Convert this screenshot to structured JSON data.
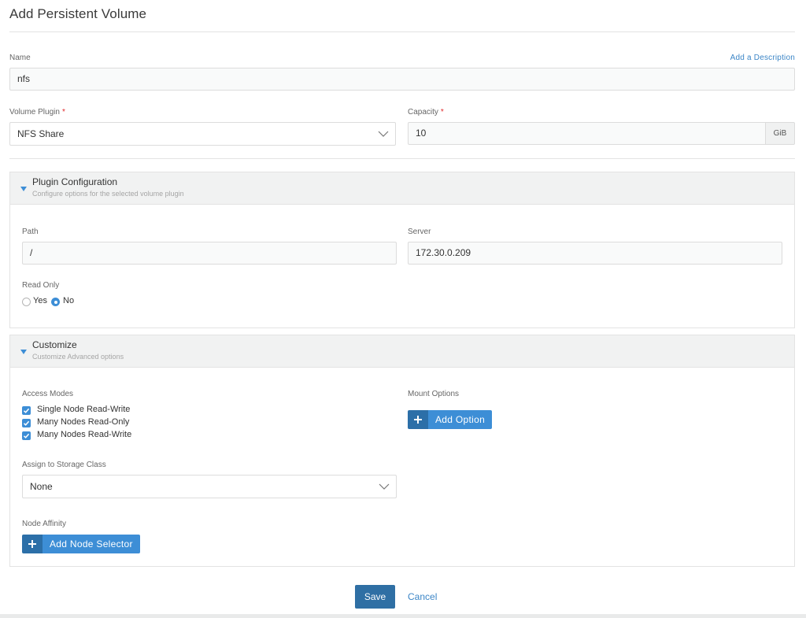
{
  "page": {
    "title": "Add Persistent Volume"
  },
  "name": {
    "label": "Name",
    "value": "nfs",
    "add_description_label": "Add a Description"
  },
  "volume_plugin": {
    "label": "Volume Plugin",
    "required_mark": "*",
    "value": "NFS Share"
  },
  "capacity": {
    "label": "Capacity",
    "required_mark": "*",
    "value": "10",
    "unit": "GiB"
  },
  "plugin_config": {
    "title": "Plugin Configuration",
    "subtitle": "Configure options for the selected volume plugin",
    "path": {
      "label": "Path",
      "value": "/"
    },
    "server": {
      "label": "Server",
      "value": "172.30.0.209"
    },
    "read_only": {
      "label": "Read Only",
      "options": [
        "Yes",
        "No"
      ],
      "selected": "No"
    }
  },
  "customize": {
    "title": "Customize",
    "subtitle": "Customize Advanced options",
    "access_modes": {
      "label": "Access Modes",
      "items": [
        {
          "label": "Single Node Read-Write",
          "checked": true
        },
        {
          "label": "Many Nodes Read-Only",
          "checked": true
        },
        {
          "label": "Many Nodes Read-Write",
          "checked": true
        }
      ]
    },
    "mount_options": {
      "label": "Mount Options",
      "add_label": "Add Option"
    },
    "storage_class": {
      "label": "Assign to Storage Class",
      "value": "None"
    },
    "node_affinity": {
      "label": "Node Affinity",
      "add_label": "Add Node Selector"
    }
  },
  "footer": {
    "save_label": "Save",
    "cancel_label": "Cancel"
  },
  "colors": {
    "accent": "#3d8ed6",
    "accent_dark": "#2c6fa8",
    "save": "#2f6fa4",
    "required": "#e0292b",
    "panel_header": "#f1f2f2"
  }
}
